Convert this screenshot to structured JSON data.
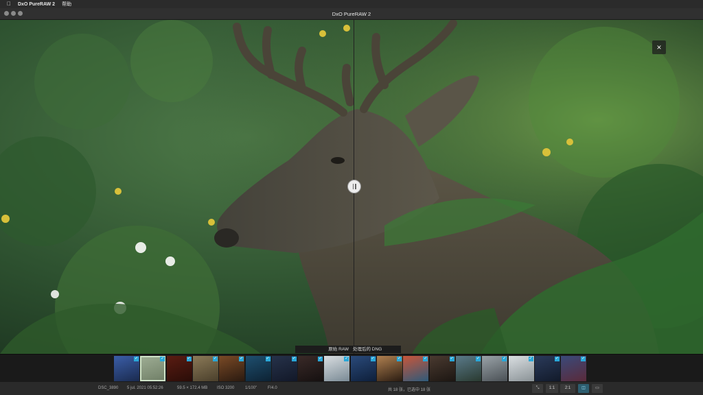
{
  "menubar": {
    "apple_icon": "apple-icon",
    "app_name": "DxO PureRAW 2",
    "help": "帮助"
  },
  "window": {
    "title": "DxO PureRAW 2"
  },
  "viewer": {
    "close_label": "×",
    "left_label": "原始 RAW",
    "right_label": "处理后的 DNG",
    "handle_icon": "split-handle-icon"
  },
  "filmstrip": {
    "count": 18,
    "selected_index": 1,
    "thumbs": [
      {
        "colors": [
          "#3b5ea8",
          "#1a2a4e"
        ]
      },
      {
        "colors": [
          "#9fae95",
          "#6f7e66"
        ]
      },
      {
        "colors": [
          "#5a1c12",
          "#2a0d08"
        ]
      },
      {
        "colors": [
          "#8b7a58",
          "#4a3f2b"
        ]
      },
      {
        "colors": [
          "#7a4a26",
          "#2a1a10"
        ]
      },
      {
        "colors": [
          "#1e4f6f",
          "#0d2233"
        ]
      },
      {
        "colors": [
          "#26324a",
          "#121828"
        ]
      },
      {
        "colors": [
          "#3a2a28",
          "#151010"
        ]
      },
      {
        "colors": [
          "#d8dde0",
          "#7a8a95"
        ]
      },
      {
        "colors": [
          "#2a4a7a",
          "#0e1f3a"
        ]
      },
      {
        "colors": [
          "#b08050",
          "#2a1c12"
        ]
      },
      {
        "colors": [
          "#c8563a",
          "#2e5a7a"
        ]
      },
      {
        "colors": [
          "#4a3a30",
          "#1c1612"
        ]
      },
      {
        "colors": [
          "#5a7a8a",
          "#2a3a30"
        ]
      },
      {
        "colors": [
          "#9aa3a8",
          "#4a5055"
        ]
      },
      {
        "colors": [
          "#dadfe2",
          "#8a9296"
        ]
      },
      {
        "colors": [
          "#2a3a5a",
          "#121a2a"
        ]
      },
      {
        "colors": [
          "#3a4a7a",
          "#5a2a3a"
        ]
      }
    ]
  },
  "status": {
    "camera": "DSC_3890",
    "date": "5 jul. 2021 05:52:26",
    "size": "59.5 × 172.4 MB",
    "iso": "ISO 3200",
    "shutter": "1/100\"",
    "aperture": "F/4.0",
    "progress": "共 18 张，已选中 18 张",
    "zoom_fit": "1:1",
    "zoom_ratio": "2:1"
  },
  "colors": {
    "accent": "#29a7d8",
    "selected_outline": "#cfe3c8"
  }
}
